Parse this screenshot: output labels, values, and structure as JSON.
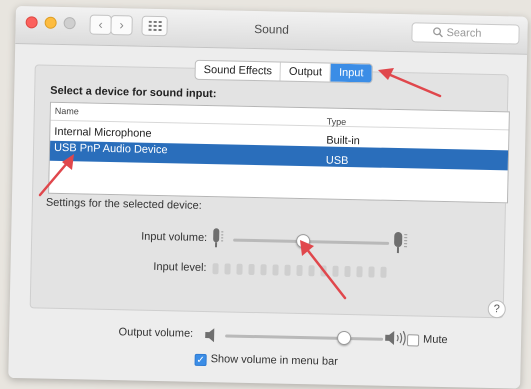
{
  "window": {
    "title": "Sound",
    "search_placeholder": "Search",
    "nav_back_glyph": "‹",
    "nav_forward_glyph": "›"
  },
  "tabs": [
    {
      "label": "Sound Effects",
      "active": false
    },
    {
      "label": "Output",
      "active": false
    },
    {
      "label": "Input",
      "active": true
    }
  ],
  "device_section": {
    "heading": "Select a device for sound input:",
    "columns": {
      "name": "Name",
      "type": "Type"
    },
    "rows": [
      {
        "name": "Internal Microphone",
        "type": "Built-in",
        "selected": false
      },
      {
        "name": "USB PnP Audio Device",
        "type": "USB",
        "selected": true
      }
    ]
  },
  "settings": {
    "label": "Settings for the selected device:",
    "input_volume_label": "Input volume:",
    "input_volume_level": 0.45,
    "input_level_label": "Input level:",
    "input_level_active_segments": 0,
    "input_level_segments": 15
  },
  "output": {
    "output_volume_label": "Output volume:",
    "output_volume_level": 0.75,
    "mute_label": "Mute",
    "mute_checked": false,
    "show_in_menubar_label": "Show volume in menu bar",
    "show_in_menubar_checked": true
  },
  "help": {
    "glyph": "?"
  },
  "colors": {
    "accent": "#3b8de6",
    "selection": "#2a6ebb",
    "annotation_arrow": "#e0474c"
  },
  "icons": [
    "close-icon",
    "minimize-icon",
    "maximize-icon",
    "grid-icon",
    "search-icon",
    "microphone-icon",
    "speaker-icon",
    "speaker-loud-icon",
    "help-icon",
    "checkmark-icon"
  ]
}
